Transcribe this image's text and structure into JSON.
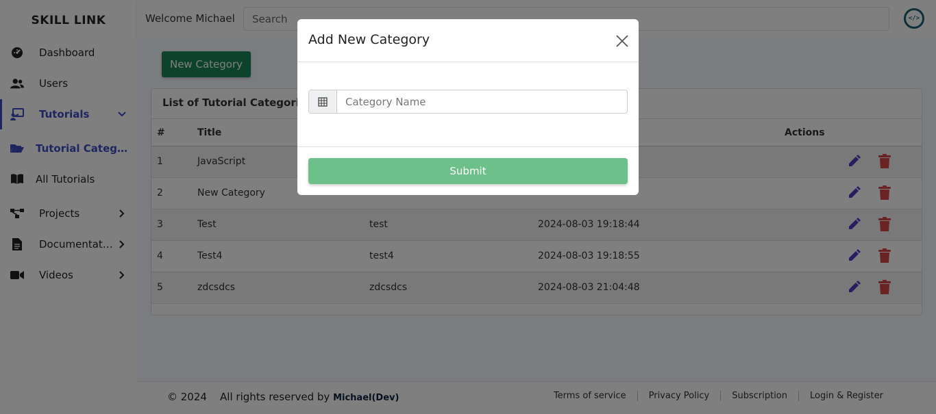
{
  "brand": "SKILL LINK",
  "header": {
    "welcome": "Welcome Michael",
    "search_placeholder": "Search",
    "logo_text": "</>"
  },
  "sidebar": {
    "items": [
      {
        "label": "Dashboard",
        "icon": "dashboard-icon"
      },
      {
        "label": "Users",
        "icon": "users-icon"
      },
      {
        "label": "Tutorials",
        "icon": "chalkboard-icon",
        "active": true,
        "chevron": "chevron-down-icon"
      },
      {
        "label": "Tutorial Category",
        "icon": "folder-open-icon",
        "active": true
      },
      {
        "label": "All Tutorials",
        "icon": "book-icon"
      },
      {
        "label": "Projects",
        "icon": "project-diagram-icon",
        "chevron": "chevron-right-icon"
      },
      {
        "label": "Documentation",
        "icon": "document-icon",
        "chevron": "chevron-right-icon"
      },
      {
        "label": "Videos",
        "icon": "video-icon",
        "chevron": "chevron-right-icon"
      }
    ]
  },
  "main": {
    "new_category_button": "New Category",
    "card_title": "List of Tutorial Categories",
    "columns": [
      "#",
      "Title",
      "",
      "",
      "Actions"
    ],
    "rows": [
      {
        "num": "1",
        "title": "JavaScript",
        "slug": "",
        "date": ""
      },
      {
        "num": "2",
        "title": "New Category",
        "slug": "",
        "date": ""
      },
      {
        "num": "3",
        "title": "Test",
        "slug": "test",
        "date": "2024-08-03 19:18:44"
      },
      {
        "num": "4",
        "title": "Test4",
        "slug": "test4",
        "date": "2024-08-03 19:18:55"
      },
      {
        "num": "5",
        "title": "zdcsdcs",
        "slug": "zdcsdcs",
        "date": "2024-08-03 21:04:48"
      }
    ]
  },
  "footer": {
    "copyright": "© 2024",
    "rights": "All rights reserved by",
    "author": "Michael(Dev)",
    "links": [
      "Terms of service",
      "Privacy Policy",
      "Subscription",
      "Login & Register"
    ]
  },
  "modal": {
    "title": "Add New Category",
    "input_placeholder": "Category Name",
    "input_icon": "table-grid-icon",
    "submit_label": "Submit"
  },
  "colors": {
    "accent": "#3b4cc0",
    "success": "#198754",
    "submit": "#6dc08a",
    "edit": "#4b3fc4",
    "delete": "#d64545"
  }
}
